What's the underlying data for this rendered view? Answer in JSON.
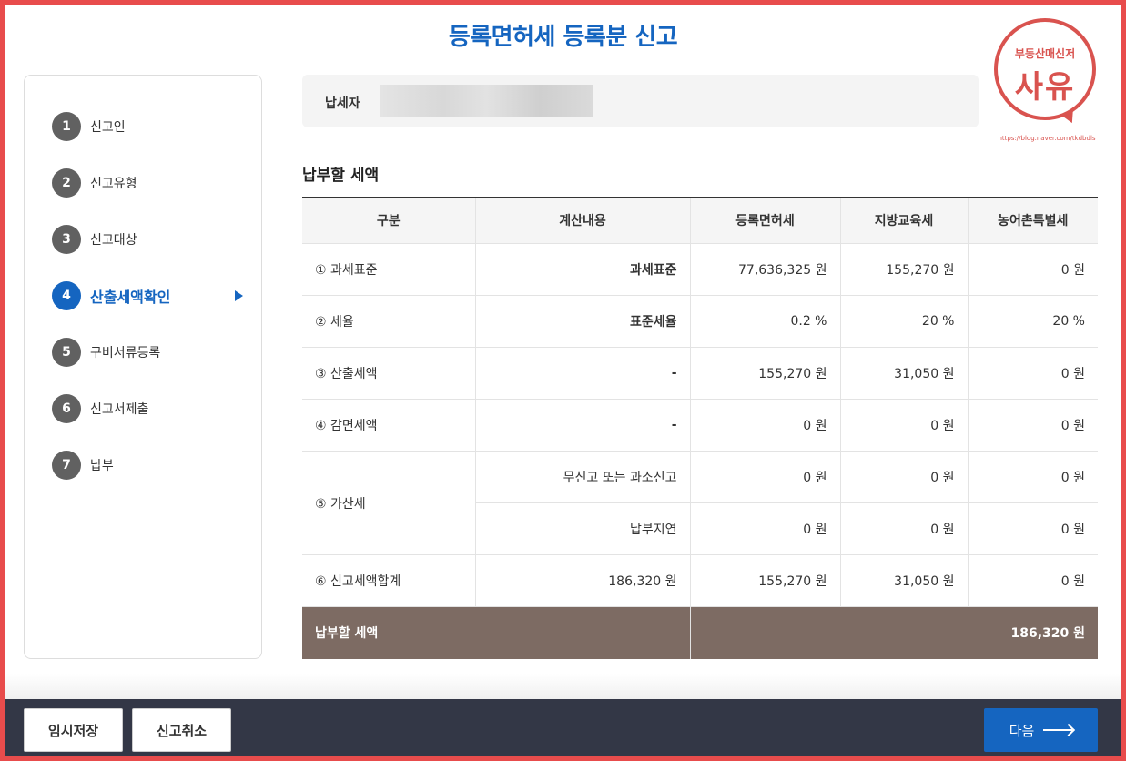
{
  "title": "등록면허세 등록분 신고",
  "logo": {
    "sub": "부동산매신저",
    "main": "사유",
    "url": "https://blog.naver.com/tkdbdls"
  },
  "steps": [
    {
      "num": "1",
      "label": "신고인"
    },
    {
      "num": "2",
      "label": "신고유형"
    },
    {
      "num": "3",
      "label": "신고대상"
    },
    {
      "num": "4",
      "label": "산출세액확인"
    },
    {
      "num": "5",
      "label": "구비서류등록"
    },
    {
      "num": "6",
      "label": "신고서제출"
    },
    {
      "num": "7",
      "label": "납부"
    }
  ],
  "active_step": "4",
  "taxpayer": {
    "label": "납세자"
  },
  "section_title": "납부할 세액",
  "table": {
    "headers": [
      "구분",
      "계산내용",
      "등록면허세",
      "지방교육세",
      "농어촌특별세"
    ],
    "rows": {
      "r1": [
        "① 과세표준",
        "과세표준",
        "77,636,325 원",
        "155,270 원",
        "0 원"
      ],
      "r2": [
        "② 세율",
        "표준세율",
        "0.2 %",
        "20 %",
        "20 %"
      ],
      "r3": [
        "③ 산출세액",
        "-",
        "155,270 원",
        "31,050 원",
        "0 원"
      ],
      "r4": [
        "④ 감면세액",
        "-",
        "0 원",
        "0 원",
        "0 원"
      ],
      "r5a": [
        "⑤ 가산세",
        "무신고 또는 과소신고",
        "0 원",
        "0 원",
        "0 원"
      ],
      "r5b": [
        "납부지연",
        "0 원",
        "0 원",
        "0 원"
      ],
      "r6": [
        "⑥ 신고세액합계",
        "186,320 원",
        "155,270 원",
        "31,050 원",
        "0 원"
      ]
    },
    "total": {
      "label": "납부할 세액",
      "value": "186,320 원"
    }
  },
  "footer": {
    "save": "임시저장",
    "cancel": "신고취소",
    "next": "다음"
  },
  "colors": {
    "accent": "#1565c0",
    "total_row": "#7d6b63",
    "footer_bg": "#333746",
    "frame": "#e84c4c"
  }
}
